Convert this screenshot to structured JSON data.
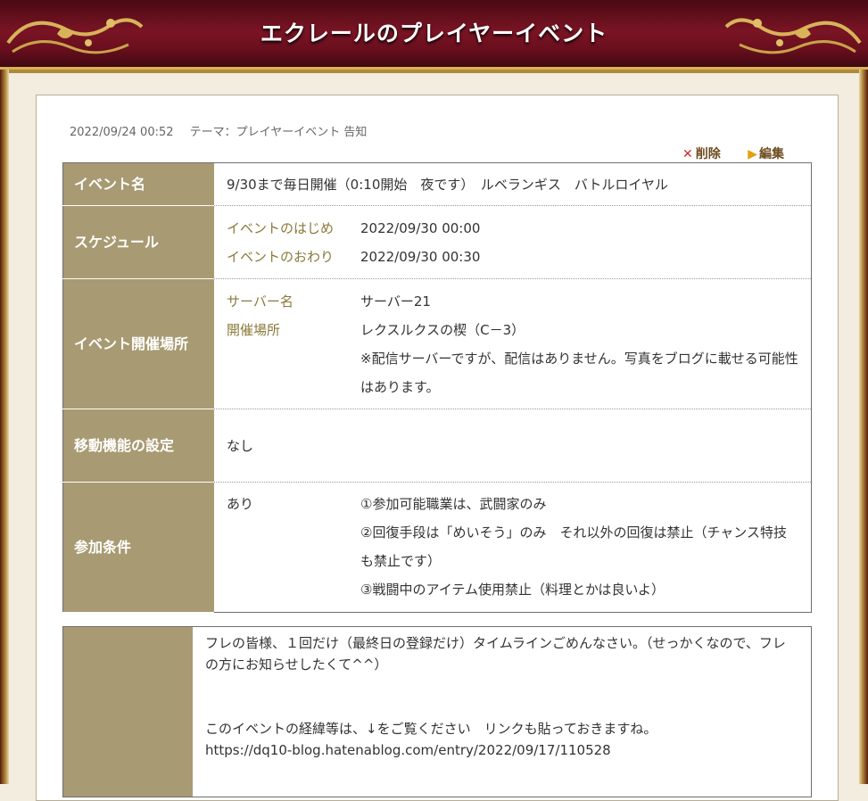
{
  "header": {
    "title": "エクレールのプレイヤーイベント"
  },
  "meta": {
    "datetime": "2022/09/24 00:52",
    "theme": "テーマ：プレイヤーイベント 告知"
  },
  "actions": {
    "delete": "削除",
    "edit": "編集"
  },
  "event": {
    "name_label": "イベント名",
    "name_value": "9/30まで毎日開催（0:10開始　夜です）　ルベランギス　バトルロイヤル",
    "schedule_label": "スケジュール",
    "start_label": "イベントのはじめ",
    "start_value": "2022/09/30 00:00",
    "end_label": "イベントのおわり",
    "end_value": "2022/09/30 00:30",
    "place_label": "イベント開催場所",
    "server_label": "サーバー名",
    "server_value": "サーバー21",
    "venue_label": "開催場所",
    "venue_value": "レクスルクスの楔（C－3）",
    "venue_note": "※配信サーバーですが、配信はありません。写真をブログに載せる可能性はあります。",
    "move_label": "移動機能の設定",
    "move_value": "なし",
    "cond_label": "参加条件",
    "cond_flag": "あり",
    "conditions": [
      "①参加可能職業は、武闘家のみ",
      "②回復手段は「めいそう」のみ　それ以外の回復は禁止（チャンス特技も禁止です）",
      "③戦闘中のアイテム使用禁止（料理とかは良いよ）"
    ]
  },
  "note": {
    "line1": "フレの皆様、１回だけ（最終日の登録だけ）タイムラインごめんなさい。（せっかくなので、フレの方にお知らせしたくて^^）",
    "line2": "このイベントの経緯等は、↓をご覧ください　リンクも貼っておきますね。",
    "link": "https://dq10-blog.hatenablog.com/entry/2022/09/17/110528"
  }
}
